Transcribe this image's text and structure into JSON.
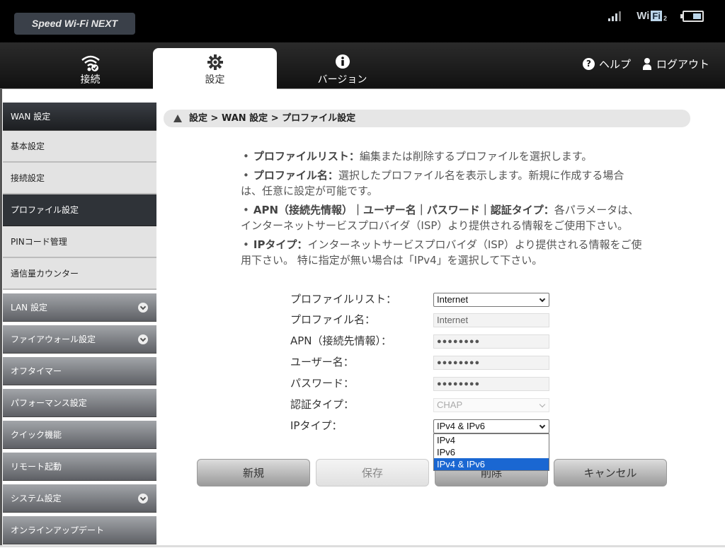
{
  "header": {
    "logo": "Speed Wi-Fi NEXT",
    "status": {
      "signal_icon": "signal-bars-icon",
      "wifi_label_prefix": "Wi",
      "wifi_label_box": "Fi",
      "wifi_label_suffix": "2",
      "battery_icon": "battery-icon"
    }
  },
  "nav": {
    "tabs": [
      {
        "label": "接続",
        "icon": "wifi-check-icon",
        "active": false
      },
      {
        "label": "設定",
        "icon": "gear-icon",
        "active": true
      },
      {
        "label": "バージョン",
        "icon": "info-icon",
        "active": false
      }
    ],
    "help_icon_glyph": "?",
    "help_label": "ヘルプ",
    "logout_label": "ログアウト"
  },
  "sidebar": {
    "items": [
      {
        "label": "WAN 設定",
        "type": "head"
      },
      {
        "label": "基本設定",
        "type": "sub"
      },
      {
        "label": "接続設定",
        "type": "sub"
      },
      {
        "label": "プロファイル設定",
        "type": "sub",
        "active": true
      },
      {
        "label": "PINコード管理",
        "type": "sub"
      },
      {
        "label": "通信量カウンター",
        "type": "sub"
      },
      {
        "label": "LAN 設定",
        "type": "group",
        "expandable": true
      },
      {
        "label": "ファイアウォール設定",
        "type": "group",
        "expandable": true
      },
      {
        "label": "オフタイマー",
        "type": "group"
      },
      {
        "label": "パフォーマンス設定",
        "type": "group"
      },
      {
        "label": "クイック機能",
        "type": "group"
      },
      {
        "label": "リモート起動",
        "type": "group"
      },
      {
        "label": "システム設定",
        "type": "group",
        "expandable": true
      },
      {
        "label": "オンラインアップデート",
        "type": "group"
      }
    ]
  },
  "breadcrumb": "設定 > WAN 設定 > プロファイル設定",
  "description": [
    {
      "title": "プロファイルリスト：",
      "text": "編集または削除するプロファイルを選択します。"
    },
    {
      "title": "プロファイル名：",
      "text": "選択したプロファイル名を表示します。新規に作成する場合は、任意に設定が可能です。"
    },
    {
      "title": "APN（接続先情報）｜ユーザー名｜パスワード｜認証タイプ：",
      "text": "各パラメータは、インターネットサービスプロバイダ（ISP）より提供される情報をご使用下さい。"
    },
    {
      "title": "IPタイプ：",
      "text": "インターネットサービスプロバイダ（ISP）より提供される情報をご使用下さい。 特に指定が無い場合は「IPv4」を選択して下さい。"
    }
  ],
  "form": {
    "profile_list": {
      "label": "プロファイルリスト：",
      "value": "Internet"
    },
    "profile_name": {
      "label": "プロファイル名：",
      "value": "Internet"
    },
    "apn": {
      "label": "APN（接続先情報）：",
      "value": "●●●●●●●●"
    },
    "username": {
      "label": "ユーザー名：",
      "value": "●●●●●●●●"
    },
    "password": {
      "label": "パスワード：",
      "value": "●●●●●●●●"
    },
    "auth_type": {
      "label": "認証タイプ：",
      "value": "CHAP"
    },
    "ip_type": {
      "label": "IPタイプ：",
      "value": "IPv4 & IPv6",
      "options": [
        "IPv4",
        "IPv6",
        "IPv4 & IPv6"
      ],
      "highlighted": "IPv4 & IPv6"
    }
  },
  "buttons": {
    "new": "新規",
    "save": "保存",
    "delete": "削除",
    "cancel": "キャンセル"
  }
}
